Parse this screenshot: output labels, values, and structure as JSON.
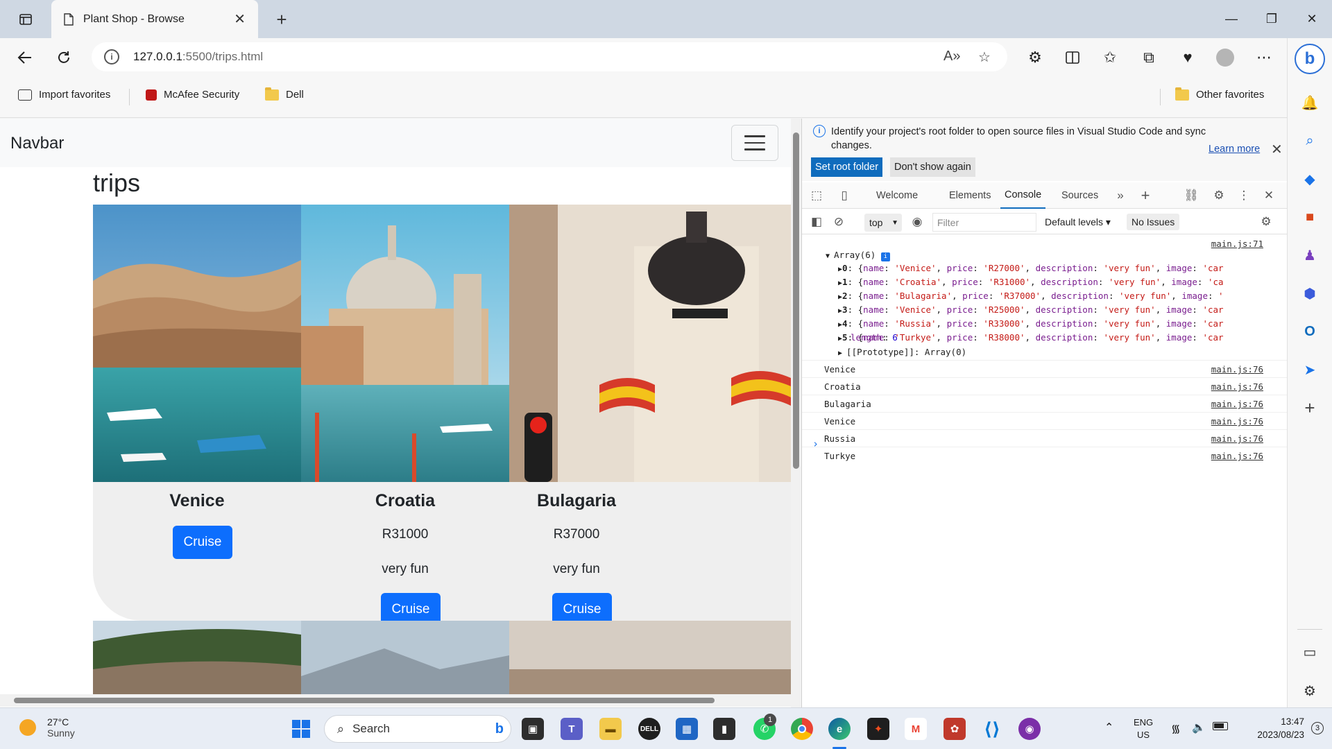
{
  "browser": {
    "tab_title": "Plant Shop - Browse",
    "url_host": "127.0.0.1",
    "url_rest": ":5500/trips.html",
    "favorites": [
      {
        "label": "Import favorites"
      },
      {
        "label": "McAfee Security"
      },
      {
        "label": "Dell"
      }
    ],
    "other_favorites": "Other favorites"
  },
  "page": {
    "brand": "Navbar",
    "heading": "trips",
    "cards": [
      {
        "name": "Venice",
        "price": "",
        "description": "",
        "button": "Cruise"
      },
      {
        "name": "Croatia",
        "price": "R31000",
        "description": "very fun",
        "button": "Cruise"
      },
      {
        "name": "Bulagaria",
        "price": "R37000",
        "description": "very fun",
        "button": "Cruise"
      }
    ]
  },
  "devtools": {
    "notice_text": "Identify your project's root folder to open source files in Visual Studio Code and sync changes.",
    "learn_more": "Learn more",
    "set_root": "Set root folder",
    "dont_show": "Don't show again",
    "tabs": [
      "Welcome",
      "Elements",
      "Console",
      "Sources"
    ],
    "active_tab": "Console",
    "context": "top",
    "filter_placeholder": "Filter",
    "levels": "Default levels",
    "issues": "No Issues",
    "array_source": "main.js:71",
    "array_label": "Array(6)",
    "array_items": [
      {
        "idx": "0",
        "name": "'Venice'",
        "price": "'R27000'",
        "desc": "'very fun'",
        "tail": "'car"
      },
      {
        "idx": "1",
        "name": "'Croatia'",
        "price": "'R31000'",
        "desc": "'very fun'",
        "tail": "'ca"
      },
      {
        "idx": "2",
        "name": "'Bulagaria'",
        "price": "'R37000'",
        "desc": "'very fun'",
        "tail": "'"
      },
      {
        "idx": "3",
        "name": "'Venice'",
        "price": "'R25000'",
        "desc": "'very fun'",
        "tail": "'car"
      },
      {
        "idx": "4",
        "name": "'Russia'",
        "price": "'R33000'",
        "desc": "'very fun'",
        "tail": "'car"
      },
      {
        "idx": "5",
        "name": "'Turkye'",
        "price": "'R38000'",
        "desc": "'very fun'",
        "tail": "'car"
      }
    ],
    "length_label": "length",
    "length_value": "6",
    "prototype": "[[Prototype]]: Array(0)",
    "logs": [
      {
        "text": "Venice",
        "source": "main.js:76"
      },
      {
        "text": "Croatia",
        "source": "main.js:76"
      },
      {
        "text": "Bulagaria",
        "source": "main.js:76"
      },
      {
        "text": "Venice",
        "source": "main.js:76"
      },
      {
        "text": "Russia",
        "source": "main.js:76"
      },
      {
        "text": "Turkye",
        "source": "main.js:76"
      }
    ]
  },
  "taskbar": {
    "temp": "27°C",
    "condition": "Sunny",
    "search": "Search",
    "lang1": "ENG",
    "lang2": "US",
    "time": "13:47",
    "date": "2023/08/23",
    "notifications": "3",
    "whatsapp_badge": "1"
  },
  "colors": {
    "primary_button": "#0d6efd",
    "devtools_accent": "#0f6cbd",
    "taskbar": "#e8edf5"
  }
}
